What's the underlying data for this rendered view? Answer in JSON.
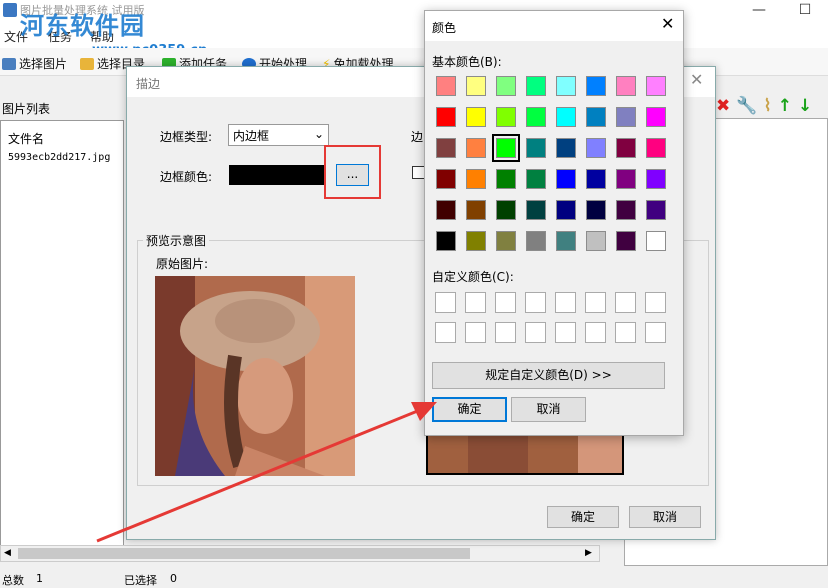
{
  "app": {
    "title": "图片批量处理系统 试用版",
    "watermark": "河东软件园",
    "watermark_url": "www.pc0359.cn",
    "menu": [
      "文件",
      "任务",
      "帮助"
    ],
    "toolbar": [
      "选择图片",
      "选择目录",
      "添加任务",
      "开始处理",
      "免加载处理"
    ],
    "list_label": "图片列表",
    "list_header": "文件名",
    "files": [
      "5993ecb2dd217.jpg"
    ],
    "status": {
      "total_label": "总数",
      "total": "1",
      "selected_label": "已选择",
      "selected": "0"
    }
  },
  "border_dialog": {
    "title": "描边",
    "border_type_label": "边框类型:",
    "border_type_value": "内边框",
    "border_color_label": "边框颜色:",
    "border_color": "#000000",
    "ellipsis": "...",
    "right_label_fragment": "边",
    "preview_group": "预览示意图",
    "original_label": "原始图片:",
    "ok": "确定",
    "cancel": "取消"
  },
  "color_dialog": {
    "title": "颜色",
    "basic_label": "基本颜色(B):",
    "basic_colors": [
      [
        "#ff8080",
        "#ffff80",
        "#80ff80",
        "#00ff80",
        "#80ffff",
        "#0080ff",
        "#ff80c0",
        "#ff80ff"
      ],
      [
        "#ff0000",
        "#ffff00",
        "#80ff00",
        "#00ff40",
        "#00ffff",
        "#0080c0",
        "#8080c0",
        "#ff00ff"
      ],
      [
        "#804040",
        "#ff8040",
        "#00ff00",
        "#008080",
        "#004080",
        "#8080ff",
        "#800040",
        "#ff0080"
      ],
      [
        "#800000",
        "#ff8000",
        "#008000",
        "#008040",
        "#0000ff",
        "#0000a0",
        "#800080",
        "#8000ff"
      ],
      [
        "#400000",
        "#804000",
        "#004000",
        "#004040",
        "#000080",
        "#000040",
        "#400040",
        "#400080"
      ],
      [
        "#000000",
        "#808000",
        "#808040",
        "#808080",
        "#408080",
        "#c0c0c0",
        "#400040",
        "#ffffff"
      ]
    ],
    "selected_color": "#00ff00",
    "custom_label": "自定义颜色(C):",
    "define_custom": "规定自定义颜色(D) >>",
    "ok": "确定",
    "cancel": "取消"
  },
  "accent_colors": {
    "highlight": "#e53935",
    "focus": "#0078d7"
  }
}
